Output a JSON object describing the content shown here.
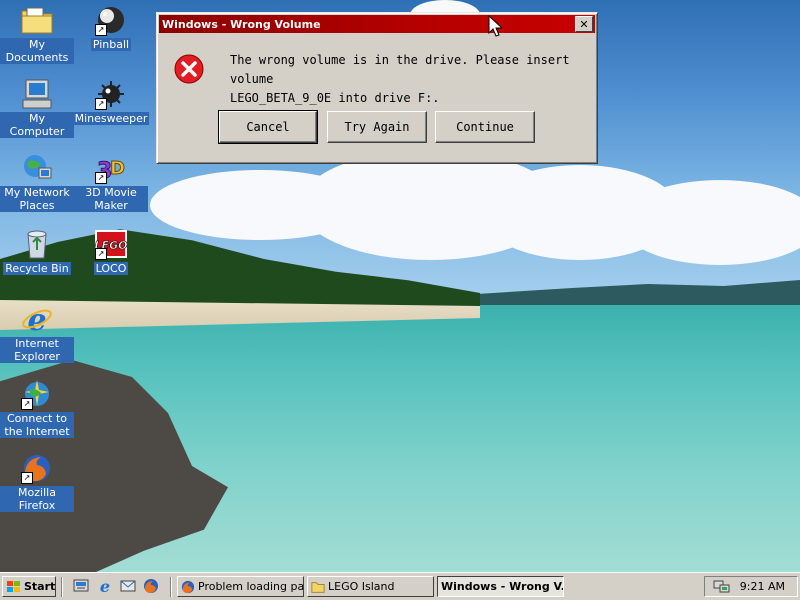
{
  "desktop": {
    "icons": [
      {
        "label": "My Documents",
        "icon": "folder-documents-icon"
      },
      {
        "label": "Pinball",
        "icon": "pinball-icon"
      },
      {
        "label": "My Computer",
        "icon": "computer-icon"
      },
      {
        "label": "Minesweeper",
        "icon": "minesweeper-icon"
      },
      {
        "label": "My Network Places",
        "icon": "network-places-icon"
      },
      {
        "label": "3D Movie Maker",
        "icon": "movie-maker-icon"
      },
      {
        "label": "Recycle Bin",
        "icon": "recycle-bin-icon"
      },
      {
        "label": "LOCO",
        "icon": "lego-icon",
        "logo_text": "LEGO"
      },
      {
        "label": "Internet Explorer",
        "icon": "internet-explorer-icon"
      },
      {
        "label": "Connect to the Internet",
        "icon": "connect-internet-icon"
      },
      {
        "label": "Mozilla Firefox",
        "icon": "firefox-icon"
      }
    ]
  },
  "dialog": {
    "title": "Windows - Wrong Volume",
    "message_line1": "The wrong volume is in the drive. Please insert volume",
    "message_line2": "LEGO_BETA_9_0E into drive F:.",
    "buttons": {
      "cancel": "Cancel",
      "retry": "Try Again",
      "continue": "Continue"
    },
    "close_glyph": "✕",
    "title_color": "#b50000"
  },
  "taskbar": {
    "start_label": "Start",
    "tasks": [
      {
        "label": "Problem loading pa...",
        "icon": "firefox-icon"
      },
      {
        "label": "LEGO Island",
        "icon": "folder-icon"
      },
      {
        "label": "Windows - Wrong V...",
        "icon": ""
      }
    ],
    "clock": "9:21 AM"
  }
}
